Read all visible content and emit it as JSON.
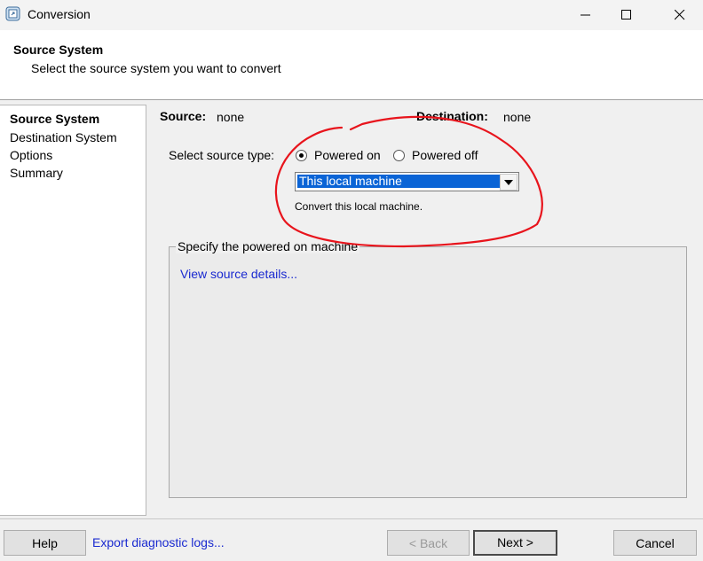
{
  "window": {
    "title": "Conversion",
    "icon": "converter-app-icon",
    "controls": [
      "minimize-icon",
      "maximize-icon",
      "close-icon"
    ]
  },
  "header": {
    "title": "Source System",
    "subtitle": "Select the source system you want to convert"
  },
  "nav": {
    "items": [
      {
        "label": "Source System",
        "active": true
      },
      {
        "label": "Destination System",
        "active": false
      },
      {
        "label": "Options",
        "active": false
      },
      {
        "label": "Summary",
        "active": false
      }
    ]
  },
  "summary": {
    "source_label": "Source:",
    "source_value": "none",
    "destination_label": "Destination:",
    "destination_value": "none"
  },
  "source_type": {
    "label": "Select source type:",
    "options": [
      {
        "label": "Powered on",
        "checked": true
      },
      {
        "label": "Powered off",
        "checked": false
      }
    ],
    "selected": "This local machine",
    "description": "Convert this local machine."
  },
  "group": {
    "title": "Specify the powered on machine",
    "link": "View source details..."
  },
  "footer": {
    "help_label": "Help",
    "export_link": "Export diagnostic logs...",
    "back_label": "< Back",
    "next_label": "Next >",
    "cancel_label": "Cancel"
  },
  "colors": {
    "selection": "#0a64d6",
    "link": "#1a2ad0",
    "annotation": "#e8141c"
  }
}
